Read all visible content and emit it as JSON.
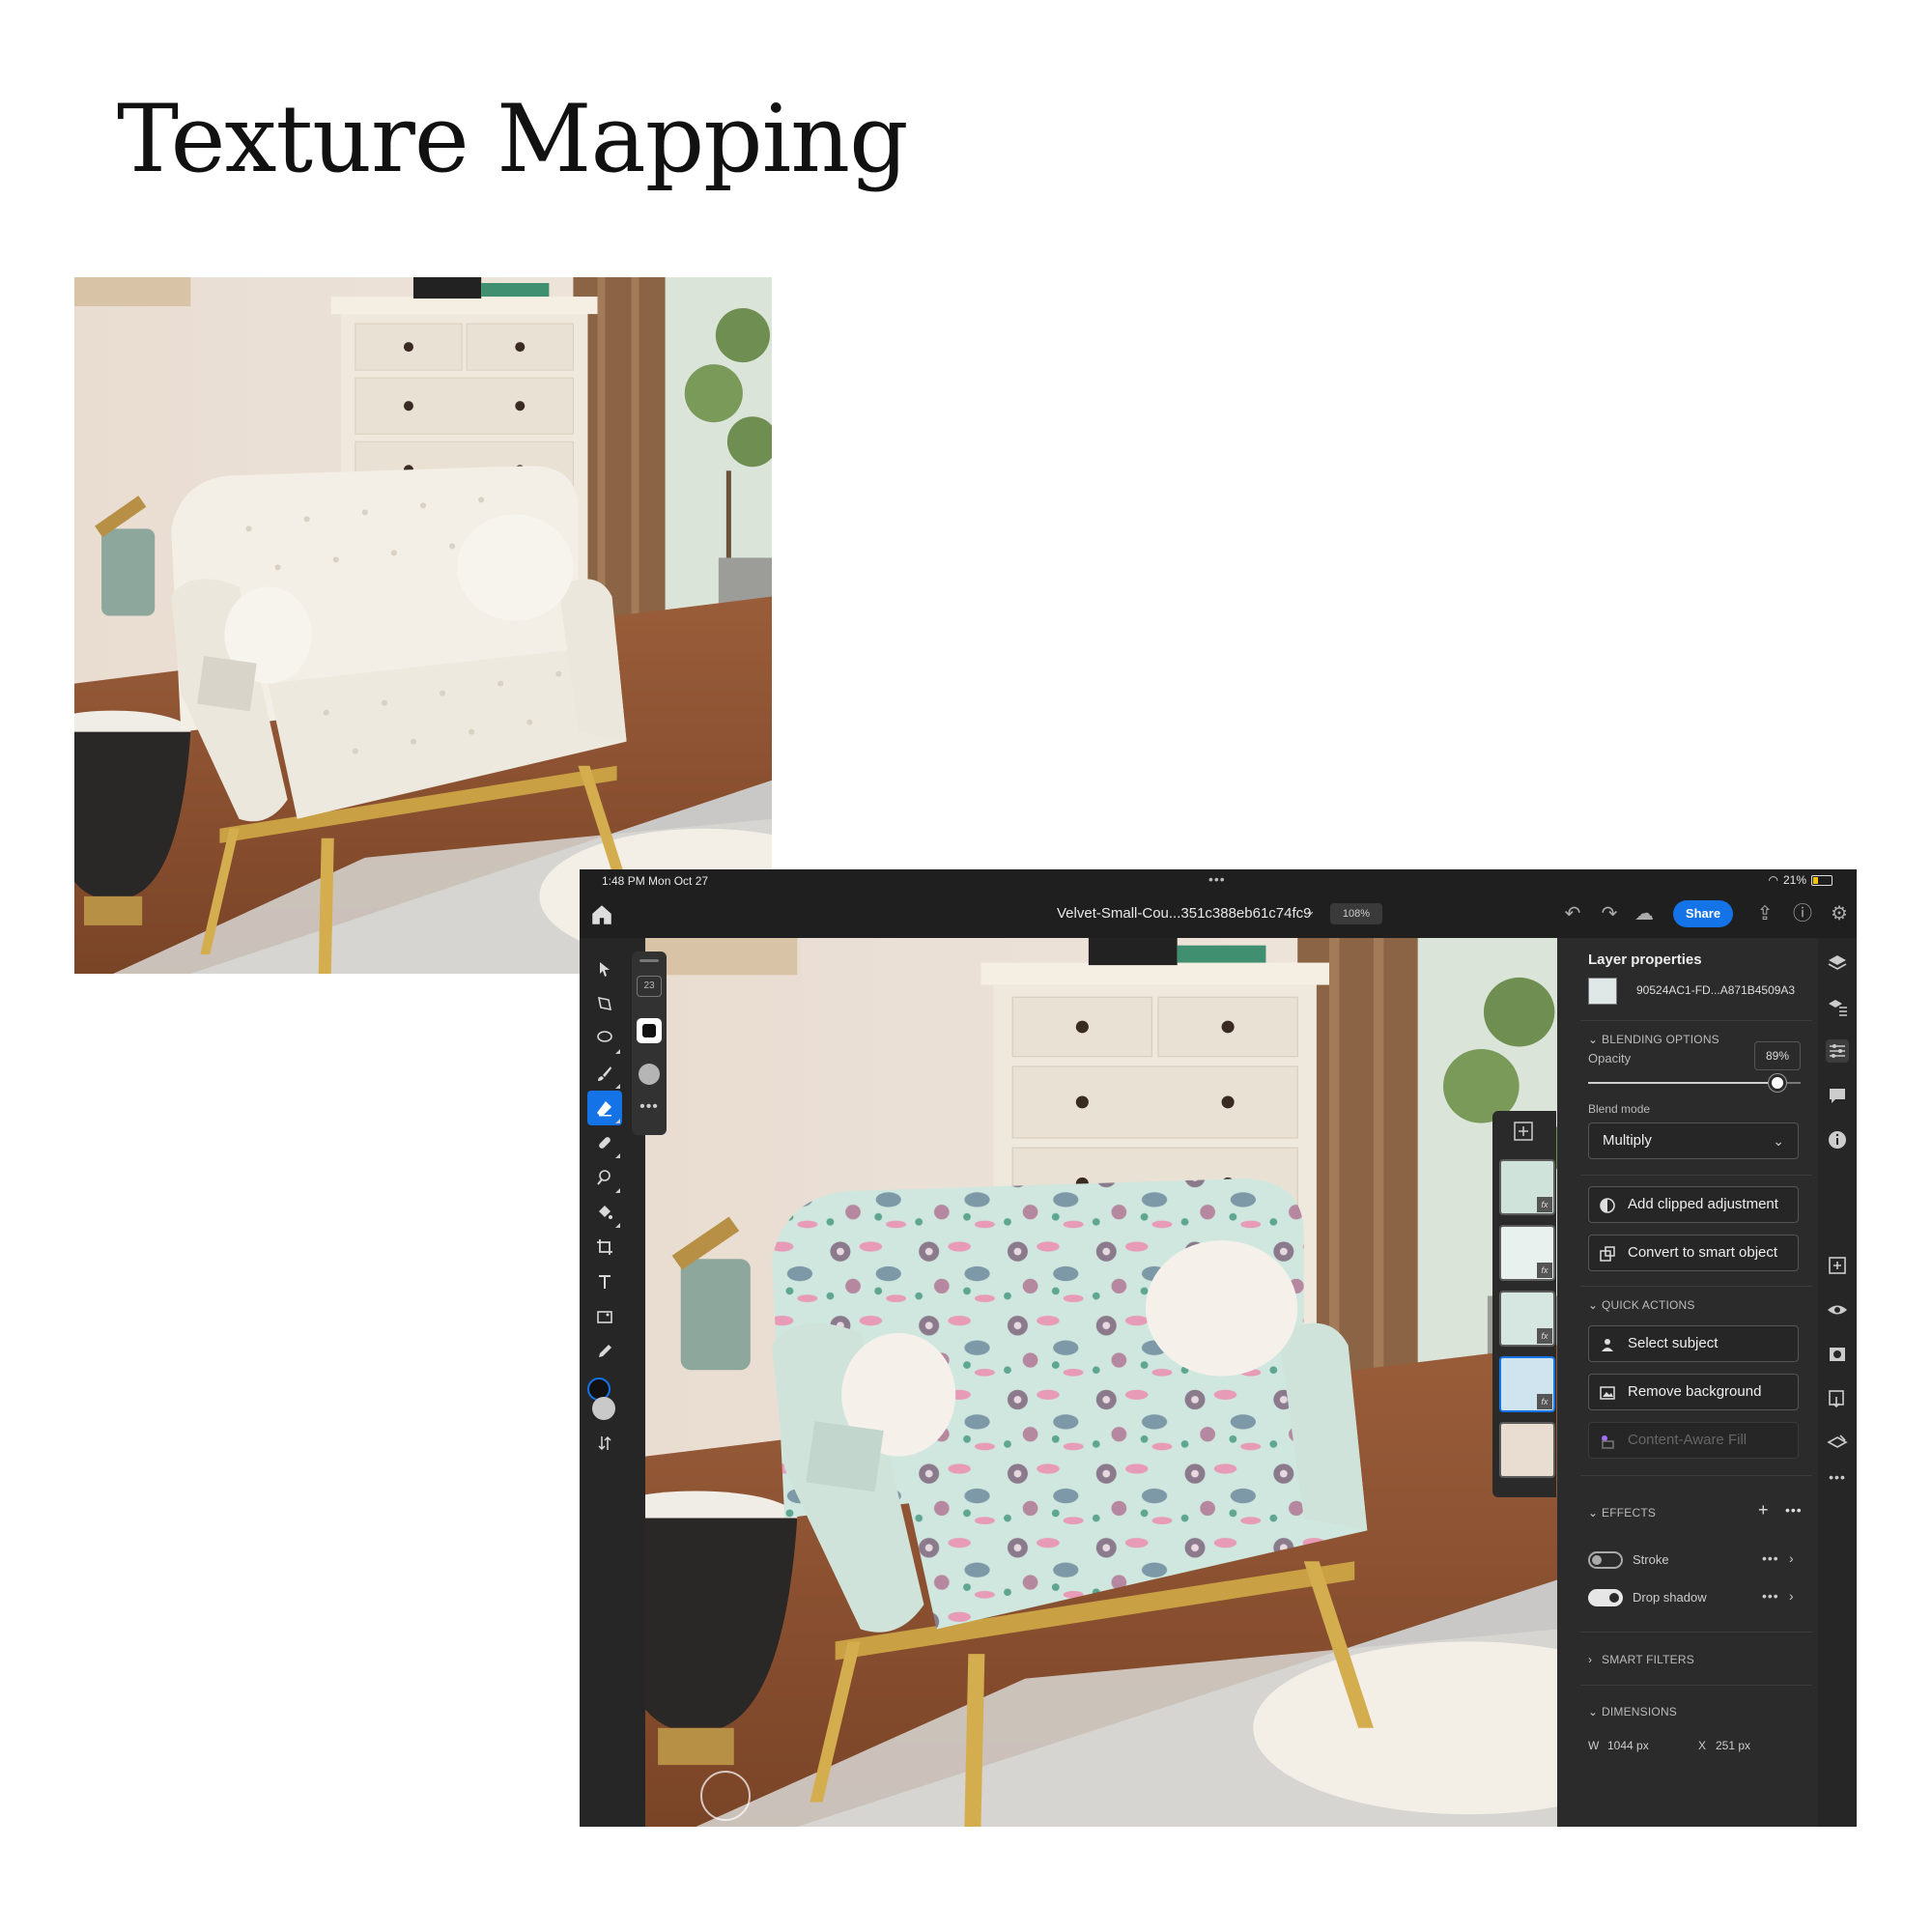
{
  "page": {
    "title": "Texture Mapping"
  },
  "status_bar": {
    "time": "1:48 PM   Mon Oct 27",
    "battery": "21%"
  },
  "top_bar": {
    "document_title": "Velvet-Small-Cou...351c388eb61c74fc9",
    "zoom": "108%",
    "share_label": "Share"
  },
  "brush_flyout": {
    "size": "23"
  },
  "layer_properties": {
    "title": "Layer properties",
    "layer_name": "90524AC1-FD...A871B4509A3",
    "blending_options": "BLENDING OPTIONS",
    "opacity_label": "Opacity",
    "opacity_value": "89%",
    "opacity_fraction": 0.89,
    "blend_mode_label": "Blend mode",
    "blend_mode_value": "Multiply",
    "add_clipped_adjustment": "Add clipped adjustment",
    "convert_to_smart_object": "Convert to smart object",
    "quick_actions": "QUICK ACTIONS",
    "select_subject": "Select subject",
    "remove_background": "Remove background",
    "content_aware_fill": "Content-Aware Fill",
    "effects": "EFFECTS",
    "stroke": "Stroke",
    "drop_shadow": "Drop shadow",
    "smart_filters": "SMART FILTERS",
    "dimensions": "DIMENSIONS",
    "width_label": "W",
    "width_value": "1044 px",
    "x_label": "X",
    "x_value": "251 px"
  },
  "colors": {
    "accent": "#1473e6",
    "panel": "#2b2b2b",
    "toolbar": "#262626"
  }
}
